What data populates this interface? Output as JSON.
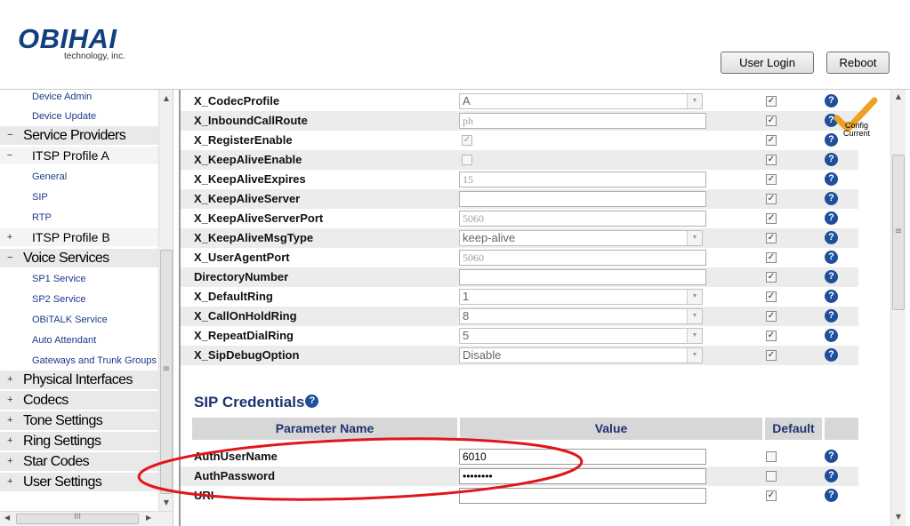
{
  "header": {
    "logo": "OBIHAI",
    "logo_sub": "technology, inc.",
    "user_login_label": "User Login",
    "reboot_label": "Reboot"
  },
  "sidebar": {
    "collapse_glyph": "−",
    "expand_glyph": "+",
    "items": [
      {
        "type": "leaf",
        "label": "Device Admin"
      },
      {
        "type": "leaf",
        "label": "Device Update"
      },
      {
        "type": "cat",
        "label": "Service Providers",
        "state": "expanded"
      },
      {
        "type": "sub",
        "label": "ITSP Profile A",
        "state": "expanded"
      },
      {
        "type": "leaf",
        "label": "General"
      },
      {
        "type": "leaf",
        "label": "SIP"
      },
      {
        "type": "leaf",
        "label": "RTP"
      },
      {
        "type": "sub",
        "label": "ITSP Profile B",
        "state": "collapsed"
      },
      {
        "type": "cat",
        "label": "Voice Services",
        "state": "expanded"
      },
      {
        "type": "leaf",
        "label": "SP1 Service"
      },
      {
        "type": "leaf",
        "label": "SP2 Service"
      },
      {
        "type": "leaf",
        "label": "OBiTALK Service"
      },
      {
        "type": "leaf",
        "label": "Auto Attendant"
      },
      {
        "type": "leaf",
        "label": "Gateways and Trunk Groups"
      },
      {
        "type": "cat",
        "label": "Physical Interfaces",
        "state": "collapsed"
      },
      {
        "type": "cat",
        "label": "Codecs",
        "state": "collapsed"
      },
      {
        "type": "cat",
        "label": "Tone Settings",
        "state": "collapsed"
      },
      {
        "type": "cat",
        "label": "Ring Settings",
        "state": "collapsed"
      },
      {
        "type": "cat",
        "label": "Star Codes",
        "state": "collapsed"
      },
      {
        "type": "cat",
        "label": "User Settings",
        "state": "collapsed"
      }
    ],
    "scrollbar_h_grip": "III",
    "scrollbar_v_grip": "≡"
  },
  "main": {
    "badge": {
      "line1": "Config",
      "line2": "Current"
    },
    "help_glyph": "?",
    "check_glyph": "✓",
    "settings": [
      {
        "name": "X_CodecProfile",
        "control": "select",
        "value": "A",
        "default": true
      },
      {
        "name": "X_InboundCallRoute",
        "control": "text",
        "value": "ph",
        "default": true
      },
      {
        "name": "X_RegisterEnable",
        "control": "checkbox",
        "checked": true,
        "default": true
      },
      {
        "name": "X_KeepAliveEnable",
        "control": "checkbox",
        "checked": false,
        "default": true
      },
      {
        "name": "X_KeepAliveExpires",
        "control": "text",
        "value": "15",
        "default": true
      },
      {
        "name": "X_KeepAliveServer",
        "control": "text",
        "value": "",
        "default": true
      },
      {
        "name": "X_KeepAliveServerPort",
        "control": "text",
        "value": "5060",
        "default": true
      },
      {
        "name": "X_KeepAliveMsgType",
        "control": "select",
        "value": "keep-alive",
        "default": true
      },
      {
        "name": "X_UserAgentPort",
        "control": "text",
        "value": "5060",
        "default": true
      },
      {
        "name": "DirectoryNumber",
        "control": "text",
        "value": "",
        "default": true
      },
      {
        "name": "X_DefaultRing",
        "control": "select",
        "value": "1",
        "default": true
      },
      {
        "name": "X_CallOnHoldRing",
        "control": "select",
        "value": "8",
        "default": true
      },
      {
        "name": "X_RepeatDialRing",
        "control": "select",
        "value": "5",
        "default": true
      },
      {
        "name": "X_SipDebugOption",
        "control": "select",
        "value": "Disable",
        "default": true
      }
    ],
    "sip_credentials": {
      "title": "SIP Credentials",
      "headers": {
        "name": "Parameter Name",
        "value": "Value",
        "default": "Default"
      },
      "rows": [
        {
          "name": "AuthUserName",
          "value": "6010",
          "default": false
        },
        {
          "name": "AuthPassword",
          "value": "••••••••",
          "default": false
        },
        {
          "name": "URI",
          "value": "",
          "default": true
        }
      ]
    },
    "annotation_color": "#e0161b"
  }
}
